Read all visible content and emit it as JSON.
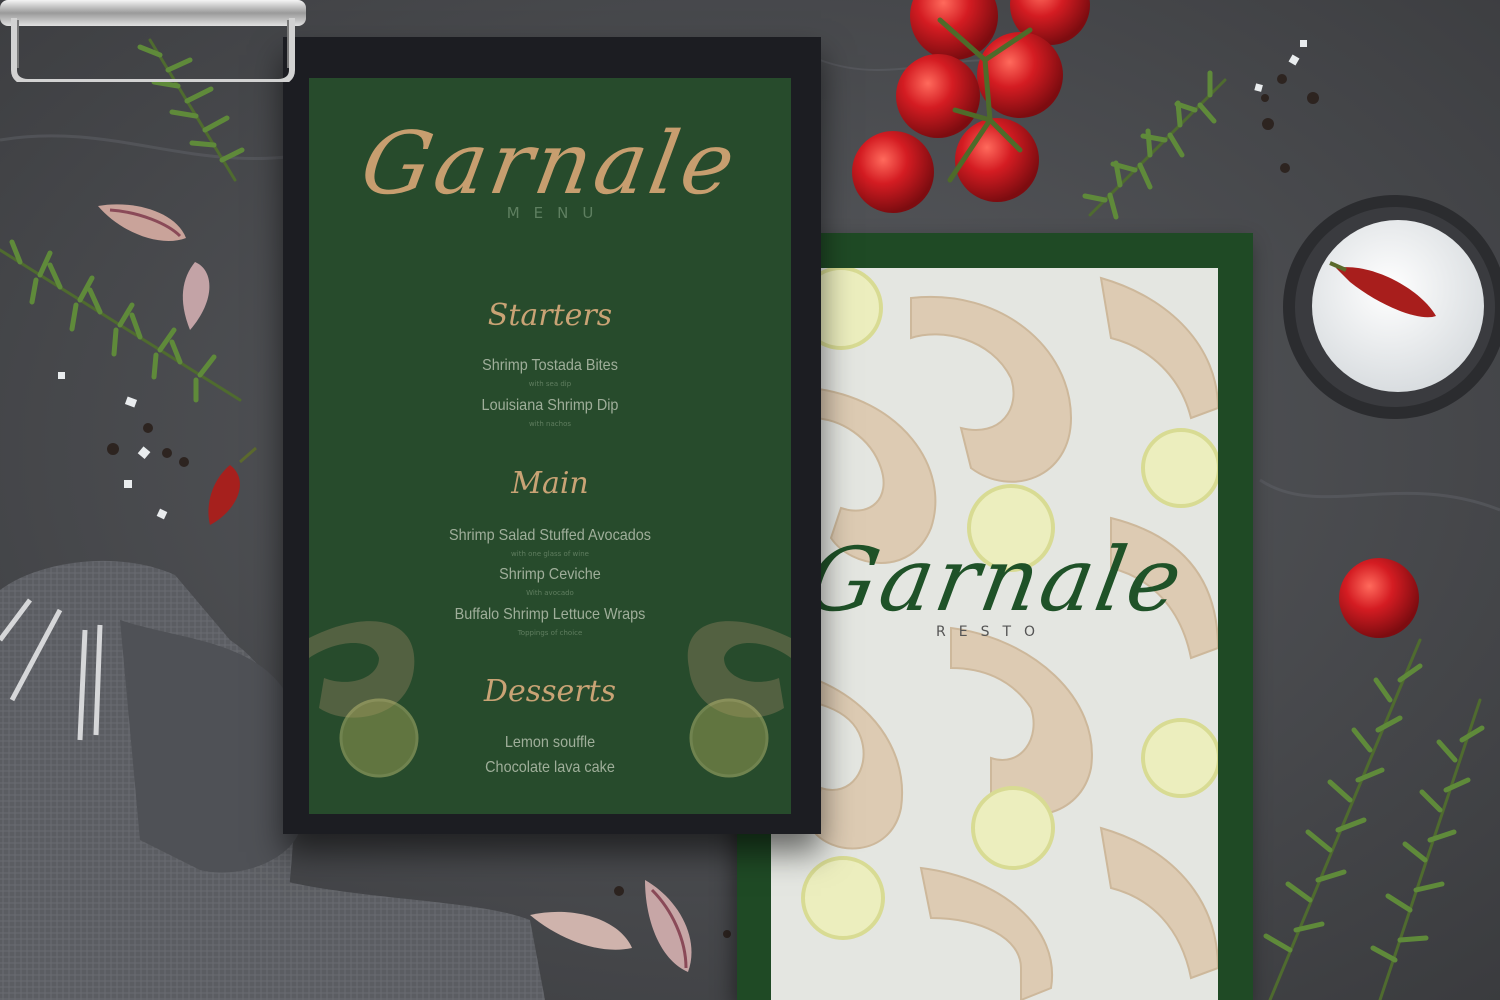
{
  "menu_card": {
    "brand": "Garnale",
    "subtitle": "MENU",
    "sections": [
      {
        "title": "Starters",
        "items": [
          {
            "name": "Shrimp Tostada Bites",
            "note": "with sea dip"
          },
          {
            "name": "Louisiana Shrimp Dip",
            "note": "with nachos"
          }
        ]
      },
      {
        "title": "Main",
        "items": [
          {
            "name": "Shrimp Salad Stuffed Avocados",
            "note": "with one glass of wine"
          },
          {
            "name": "Shrimp Ceviche",
            "note": "With avocado"
          },
          {
            "name": "Buffalo Shrimp Lettuce Wraps",
            "note": "Toppings of choice"
          }
        ]
      },
      {
        "title": "Desserts",
        "items": [
          {
            "name": "Lemon souffle",
            "note": ""
          },
          {
            "name": "Chocolate lava cake",
            "note": ""
          }
        ]
      }
    ]
  },
  "cover_card": {
    "brand": "Garnale",
    "subtitle": "RESTO"
  },
  "colors": {
    "table": "#4b4d50",
    "menu_green": "#274b2c",
    "gold": "#c9a375",
    "cover_green": "#1f4a25",
    "tomato": "#c6161c"
  },
  "props": [
    "rosemary-sprig",
    "garlic-clove",
    "cherry-tomato",
    "dried-chili",
    "salt-bowl",
    "peppercorn",
    "linen-napkin",
    "metal-clip"
  ]
}
